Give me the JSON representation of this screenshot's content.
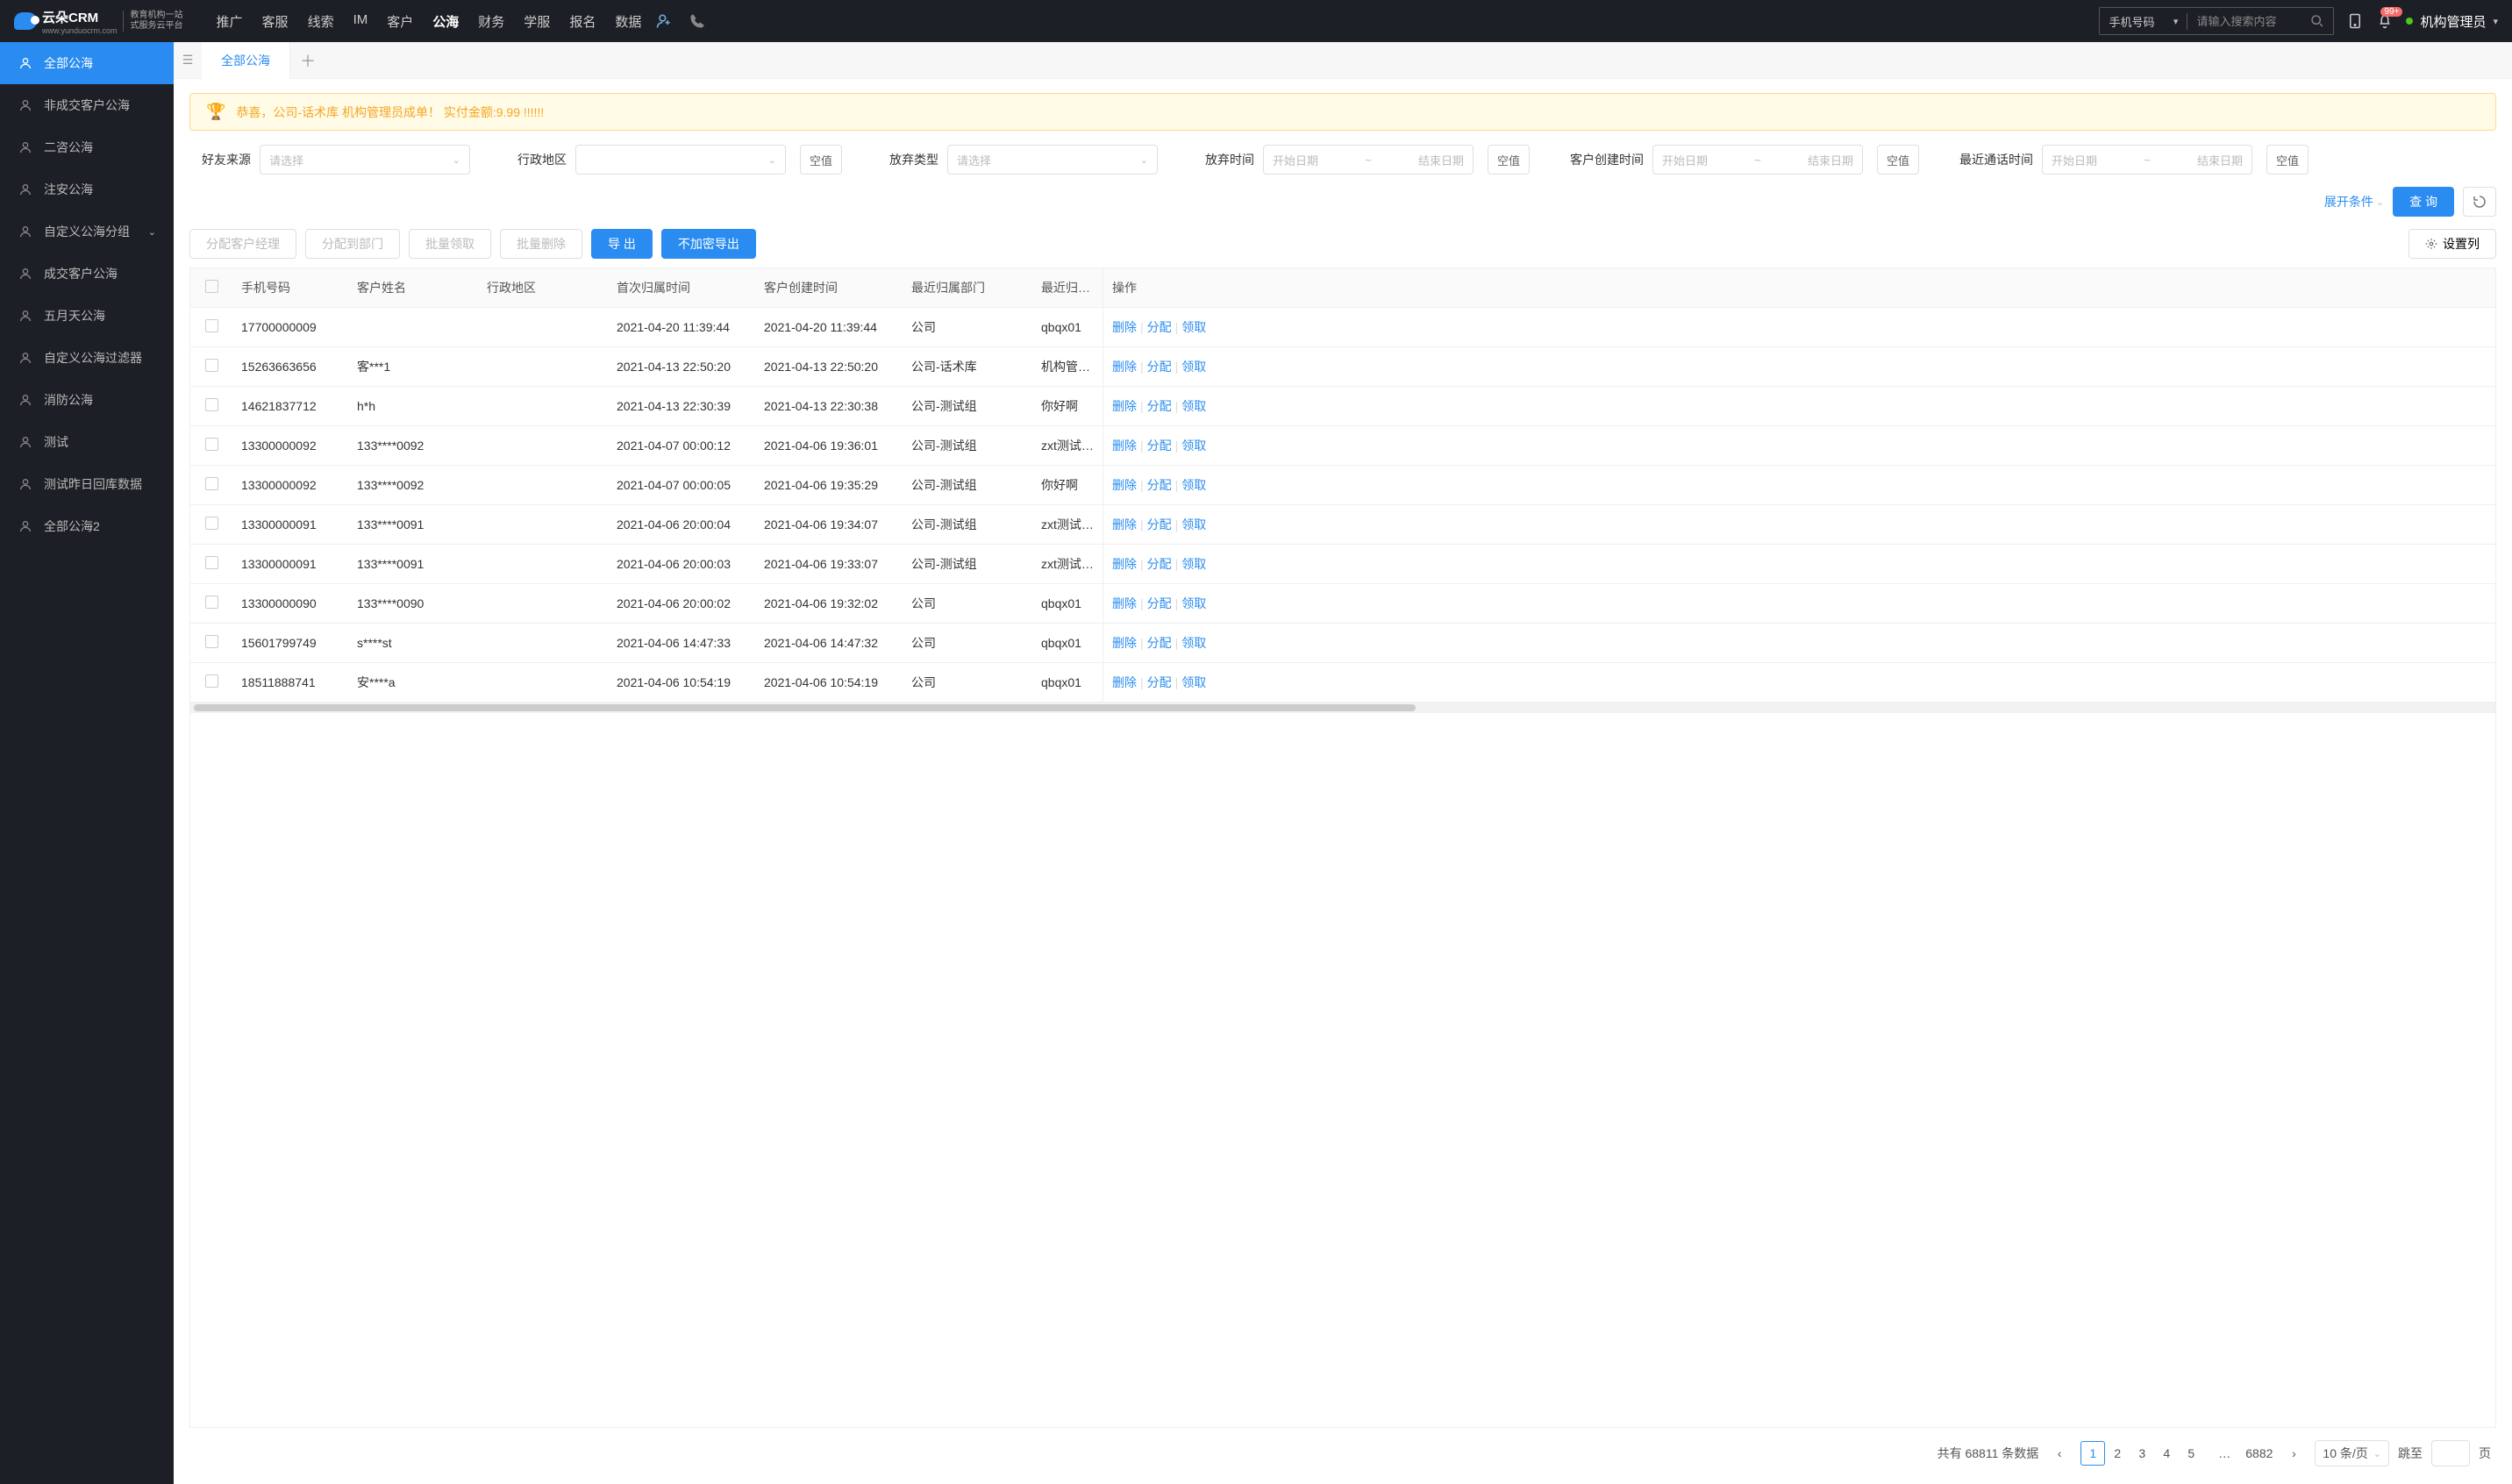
{
  "logo": {
    "brand": "云朵CRM",
    "url": "www.yunduocrm.com",
    "sub1": "教育机构一站",
    "sub2": "式服务云平台"
  },
  "nav": [
    "推广",
    "客服",
    "线索",
    "IM",
    "客户",
    "公海",
    "财务",
    "学服",
    "报名",
    "数据"
  ],
  "nav_active_index": 5,
  "search": {
    "type": "手机号码",
    "placeholder": "请输入搜索内容"
  },
  "badge": "99+",
  "user": "机构管理员",
  "sidebar": [
    {
      "label": "全部公海"
    },
    {
      "label": "非成交客户公海"
    },
    {
      "label": "二咨公海"
    },
    {
      "label": "注安公海"
    },
    {
      "label": "自定义公海分组",
      "expand": true
    },
    {
      "label": "成交客户公海"
    },
    {
      "label": "五月天公海"
    },
    {
      "label": "自定义公海过滤器"
    },
    {
      "label": "消防公海"
    },
    {
      "label": "测试"
    },
    {
      "label": "测试昨日回库数据"
    },
    {
      "label": "全部公海2"
    }
  ],
  "sidebar_active_index": 0,
  "tabs": {
    "main": "全部公海"
  },
  "notice": "恭喜，公司-话术库  机构管理员成单！  实付金额:9.99 !!!!!!",
  "filter_labels": {
    "friend_src": "好友来源",
    "region": "行政地区",
    "abandon_type": "放弃类型",
    "abandon_time": "放弃时间",
    "create_time": "客户创建时间",
    "last_call": "最近通话时间",
    "select_ph": "请选择",
    "start_ph": "开始日期",
    "end_ph": "结束日期",
    "null_btn": "空值",
    "expand": "展开条件",
    "query": "查 询"
  },
  "toolbar": {
    "assign_mgr": "分配客户经理",
    "assign_dept": "分配到部门",
    "batch_claim": "批量领取",
    "batch_del": "批量删除",
    "export": "导 出",
    "export_plain": "不加密导出",
    "set_cols": "设置列"
  },
  "columns": {
    "phone": "手机号码",
    "name": "客户姓名",
    "region": "行政地区",
    "first": "首次归属时间",
    "create": "客户创建时间",
    "dept": "最近归属部门",
    "person": "最近归属人",
    "ops": "操作"
  },
  "ops": {
    "del": "删除",
    "assign": "分配",
    "claim": "领取"
  },
  "rows": [
    {
      "phone": "17700000009",
      "name": "",
      "region": "",
      "first": "2021-04-20 11:39:44",
      "create": "2021-04-20 11:39:44",
      "dept": "公司",
      "person": "qbqx01"
    },
    {
      "phone": "15263663656",
      "name": "客***1",
      "region": "",
      "first": "2021-04-13 22:50:20",
      "create": "2021-04-13 22:50:20",
      "dept": "公司-话术库",
      "person": "机构管理员"
    },
    {
      "phone": "14621837712",
      "name": "h*h",
      "region": "",
      "first": "2021-04-13 22:30:39",
      "create": "2021-04-13 22:30:38",
      "dept": "公司-测试组",
      "person": "你好啊"
    },
    {
      "phone": "13300000092",
      "name": "133****0092",
      "region": "",
      "first": "2021-04-07 00:00:12",
      "create": "2021-04-06 19:36:01",
      "dept": "公司-测试组",
      "person": "zxt测试导入"
    },
    {
      "phone": "13300000092",
      "name": "133****0092",
      "region": "",
      "first": "2021-04-07 00:00:05",
      "create": "2021-04-06 19:35:29",
      "dept": "公司-测试组",
      "person": "你好啊"
    },
    {
      "phone": "13300000091",
      "name": "133****0091",
      "region": "",
      "first": "2021-04-06 20:00:04",
      "create": "2021-04-06 19:34:07",
      "dept": "公司-测试组",
      "person": "zxt测试导入"
    },
    {
      "phone": "13300000091",
      "name": "133****0091",
      "region": "",
      "first": "2021-04-06 20:00:03",
      "create": "2021-04-06 19:33:07",
      "dept": "公司-测试组",
      "person": "zxt测试导入"
    },
    {
      "phone": "13300000090",
      "name": "133****0090",
      "region": "",
      "first": "2021-04-06 20:00:02",
      "create": "2021-04-06 19:32:02",
      "dept": "公司",
      "person": "qbqx01"
    },
    {
      "phone": "15601799749",
      "name": "s****st",
      "region": "",
      "first": "2021-04-06 14:47:33",
      "create": "2021-04-06 14:47:32",
      "dept": "公司",
      "person": "qbqx01"
    },
    {
      "phone": "18511888741",
      "name": "安****a",
      "region": "",
      "first": "2021-04-06 10:54:19",
      "create": "2021-04-06 10:54:19",
      "dept": "公司",
      "person": "qbqx01"
    }
  ],
  "pager": {
    "total_prefix": "共有",
    "total": "68811",
    "total_suffix": "条数据",
    "pages": [
      "1",
      "2",
      "3",
      "4",
      "5"
    ],
    "last": "6882",
    "size_label": "10 条/页",
    "jump_prefix": "跳至",
    "jump_suffix": "页"
  }
}
